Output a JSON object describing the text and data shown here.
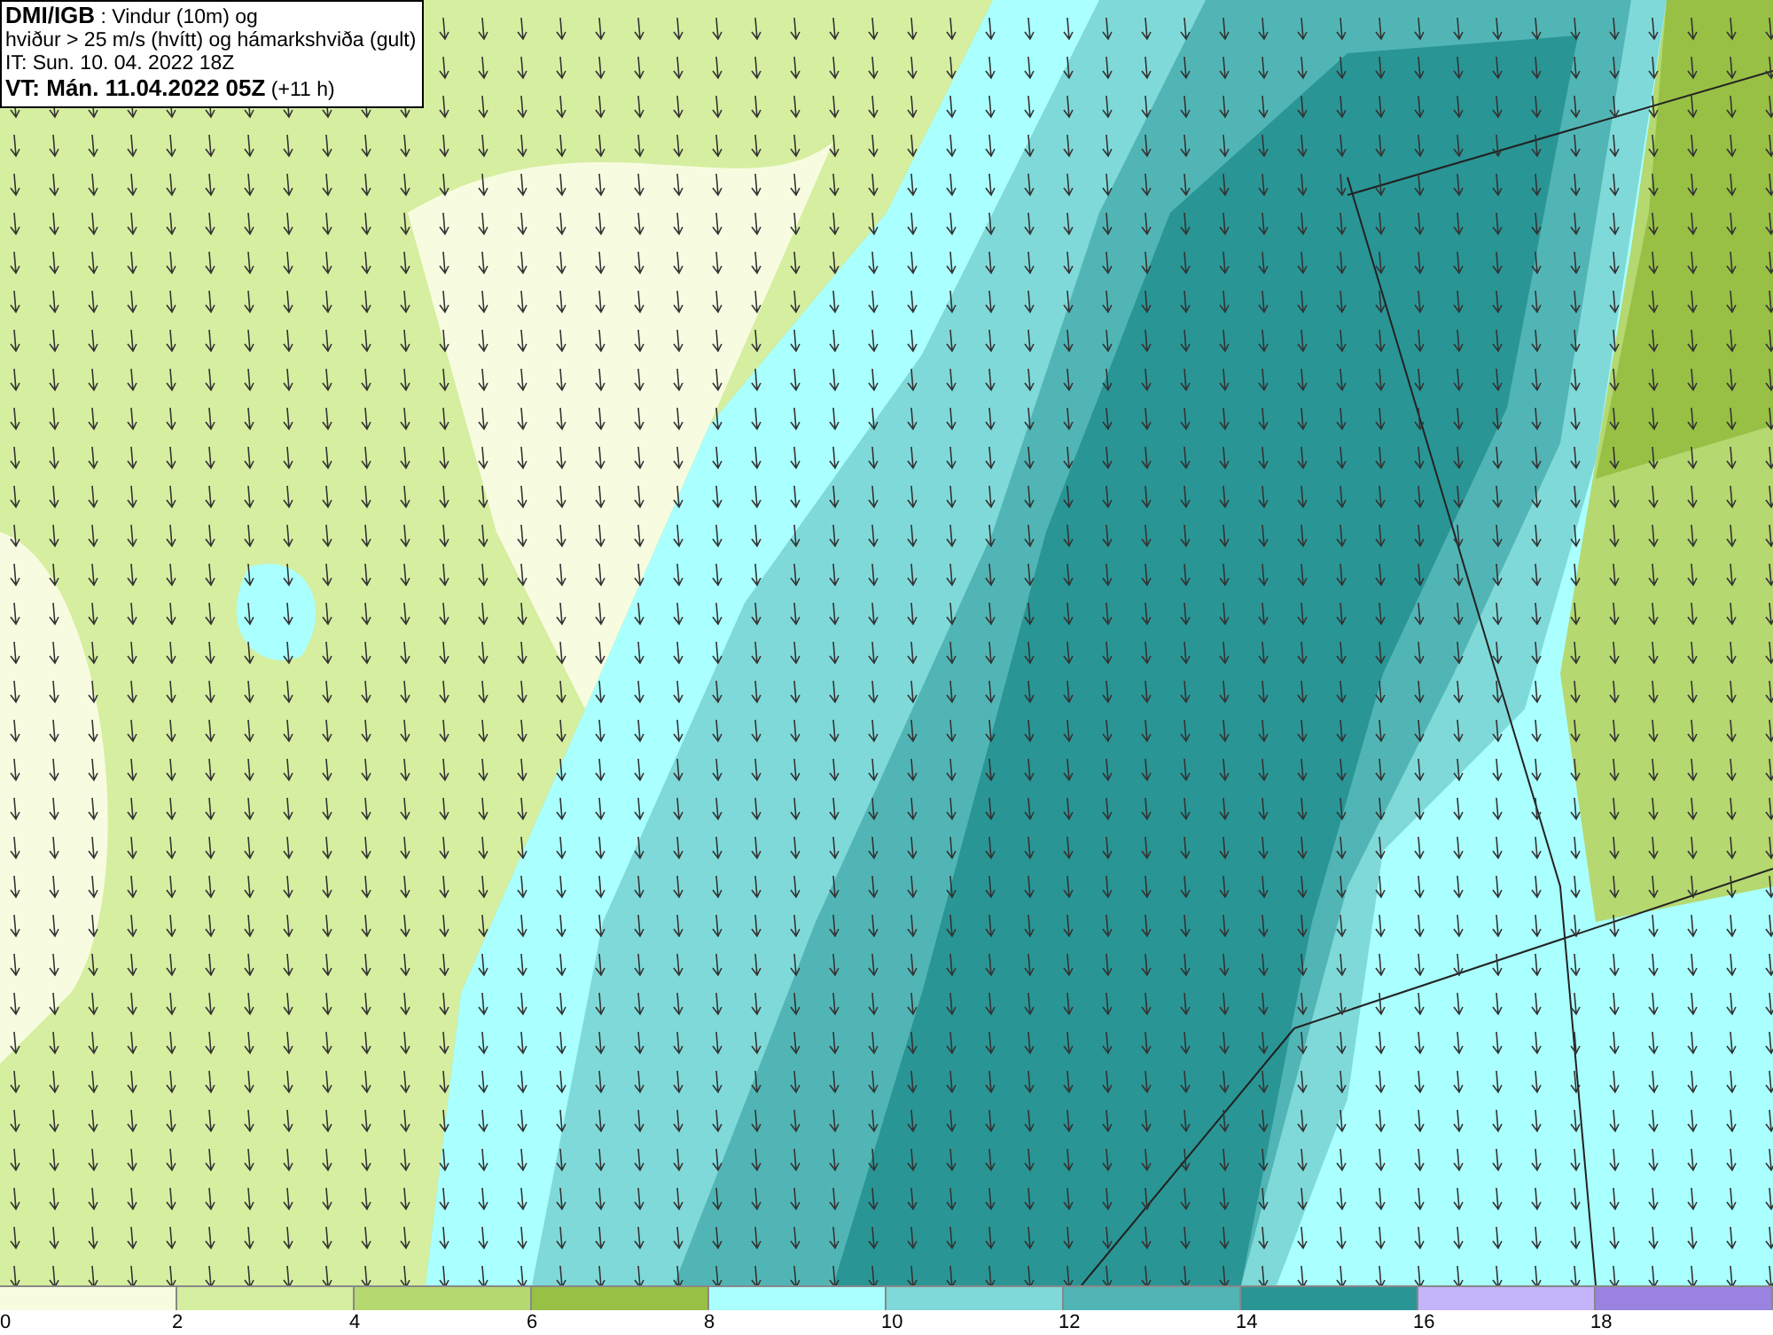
{
  "info": {
    "lines": [
      "**DMI/IGB** : Vindur (10m) og",
      "hviður > 25 m/s (hvítt) og hámarkshviða (gult)",
      "IT: Sun. 10. 04. 2022 18Z",
      "**VT: Mán. 11.04.2022 05Z** (+11 h)"
    ]
  },
  "legend": [
    {
      "label": "0",
      "color": "#f7fce0"
    },
    {
      "label": "2",
      "color": "#d6eea0"
    },
    {
      "label": "4",
      "color": "#b5d870"
    },
    {
      "label": "6",
      "color": "#97c045"
    },
    {
      "label": "8",
      "color": "#aaffff"
    },
    {
      "label": "10",
      "color": "#80d9d9"
    },
    {
      "label": "12",
      "color": "#52b5b5"
    },
    {
      "label": "14",
      "color": "#2a9595"
    },
    {
      "label": "16",
      "color": "#c4b4fa"
    },
    {
      "label": "18",
      "color": "#9a82e0"
    }
  ]
}
